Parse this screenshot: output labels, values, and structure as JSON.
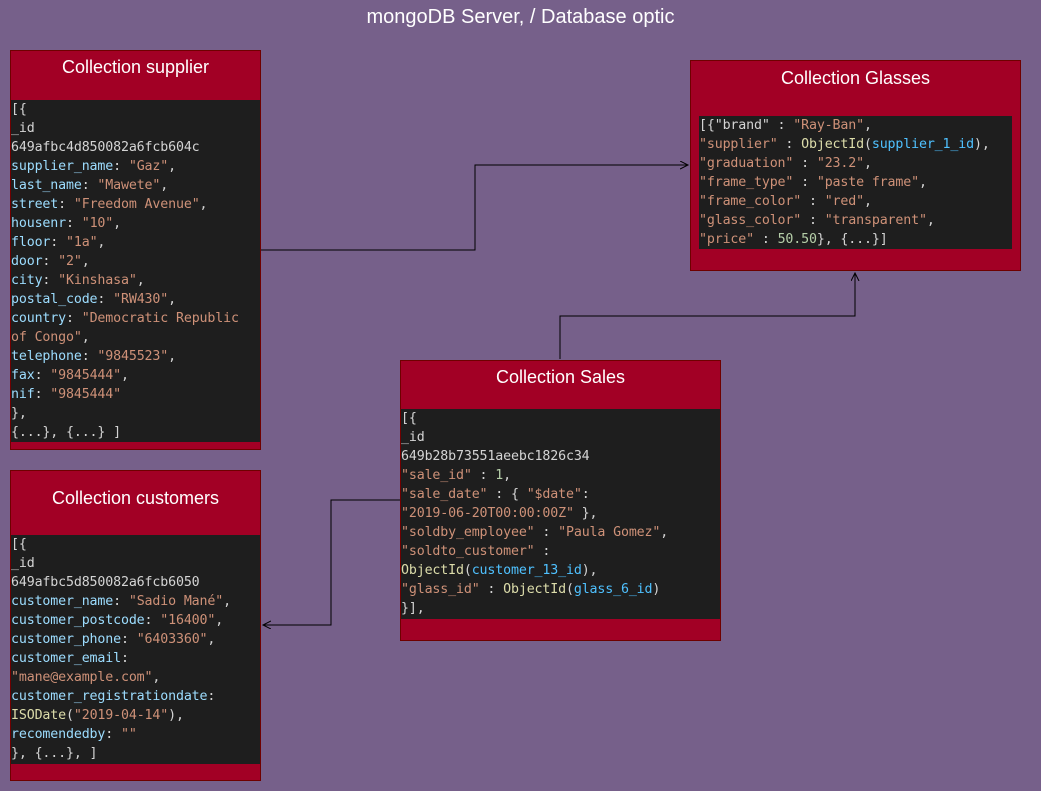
{
  "diagram_title": "mongoDB Server, / Database optic",
  "supplier": {
    "title": "Collection supplier",
    "lines": [
      [
        [
          "p",
          "[{"
        ]
      ],
      [
        [
          "p",
          "_id"
        ]
      ],
      [
        [
          "p",
          "649afbc4d850082a6fcb604c"
        ]
      ],
      [
        [
          "k",
          "supplier_name"
        ],
        [
          "p",
          ": "
        ],
        [
          "s",
          "\"Gaz\""
        ],
        [
          "p",
          ","
        ]
      ],
      [
        [
          "k",
          "last_name"
        ],
        [
          "p",
          ": "
        ],
        [
          "s",
          "\"Mawete\""
        ],
        [
          "p",
          ","
        ]
      ],
      [
        [
          "k",
          "street"
        ],
        [
          "p",
          ": "
        ],
        [
          "s",
          "\"Freedom Avenue\""
        ],
        [
          "p",
          ","
        ]
      ],
      [
        [
          "k",
          "housenr"
        ],
        [
          "p",
          ": "
        ],
        [
          "s",
          "\"10\""
        ],
        [
          "p",
          ","
        ]
      ],
      [
        [
          "k",
          "floor"
        ],
        [
          "p",
          ": "
        ],
        [
          "s",
          "\"1a\""
        ],
        [
          "p",
          ","
        ]
      ],
      [
        [
          "k",
          "door"
        ],
        [
          "p",
          ": "
        ],
        [
          "s",
          "\"2\""
        ],
        [
          "p",
          ","
        ]
      ],
      [
        [
          "k",
          "city"
        ],
        [
          "p",
          ": "
        ],
        [
          "s",
          "\"Kinshasa\""
        ],
        [
          "p",
          ","
        ]
      ],
      [
        [
          "k",
          "postal_code"
        ],
        [
          "p",
          ": "
        ],
        [
          "s",
          "\"RW430\""
        ],
        [
          "p",
          ","
        ]
      ],
      [
        [
          "k",
          "country"
        ],
        [
          "p",
          ": "
        ],
        [
          "s",
          "\"Democratic Republic"
        ]
      ],
      [
        [
          "s",
          "of Congo\""
        ],
        [
          "p",
          ","
        ]
      ],
      [
        [
          "k",
          "telephone"
        ],
        [
          "p",
          ": "
        ],
        [
          "s",
          "\"9845523\""
        ],
        [
          "p",
          ","
        ]
      ],
      [
        [
          "k",
          "fax"
        ],
        [
          "p",
          ": "
        ],
        [
          "s",
          "\"9845444\""
        ],
        [
          "p",
          ","
        ]
      ],
      [
        [
          "k",
          "nif"
        ],
        [
          "p",
          ": "
        ],
        [
          "s",
          "\"9845444\""
        ]
      ],
      [
        [
          "p",
          "},"
        ]
      ],
      [
        [
          "p",
          "{...}, {...} ]"
        ]
      ]
    ]
  },
  "glasses": {
    "title": "Collection Glasses",
    "lines": [
      [
        [
          "p",
          "[{\"brand\" : "
        ],
        [
          "s",
          "\"Ray-Ban\""
        ],
        [
          "p",
          ","
        ]
      ],
      [
        [
          "s",
          "\"supplier\""
        ],
        [
          "p",
          " : "
        ],
        [
          "f",
          "ObjectId"
        ],
        [
          "p",
          "("
        ],
        [
          "v",
          "supplier_1_id"
        ],
        [
          "p",
          "),"
        ]
      ],
      [
        [
          "s",
          "\"graduation\""
        ],
        [
          "p",
          " : "
        ],
        [
          "s",
          "\"23.2\""
        ],
        [
          "p",
          ","
        ]
      ],
      [
        [
          "s",
          "\"frame_type\""
        ],
        [
          "p",
          " : "
        ],
        [
          "s",
          "\"paste frame\""
        ],
        [
          "p",
          ","
        ]
      ],
      [
        [
          "s",
          "\"frame_color\""
        ],
        [
          "p",
          " : "
        ],
        [
          "s",
          "\"red\""
        ],
        [
          "p",
          ","
        ]
      ],
      [
        [
          "s",
          "\"glass_color\""
        ],
        [
          "p",
          " : "
        ],
        [
          "s",
          "\"transparent\""
        ],
        [
          "p",
          ","
        ]
      ],
      [
        [
          "s",
          "\"price\""
        ],
        [
          "p",
          " : "
        ],
        [
          "n",
          "50.50"
        ],
        [
          "p",
          "}, {...}]"
        ]
      ]
    ]
  },
  "sales": {
    "title": "Collection Sales",
    "lines": [
      [
        [
          "p",
          "[{"
        ]
      ],
      [
        [
          "p",
          "_id"
        ]
      ],
      [
        [
          "p",
          "649b28b73551aeebc1826c34"
        ]
      ],
      [
        [
          "s",
          "\"sale_id\""
        ],
        [
          "p",
          " : "
        ],
        [
          "n",
          "1"
        ],
        [
          "p",
          ","
        ]
      ],
      [
        [
          "s",
          "\"sale_date\""
        ],
        [
          "p",
          " : { "
        ],
        [
          "s",
          "\"$date\""
        ],
        [
          "p",
          ":"
        ]
      ],
      [
        [
          "s",
          "\"2019-06-20T00:00:00Z\""
        ],
        [
          "p",
          " },"
        ]
      ],
      [
        [
          "s",
          "\"soldby_employee\""
        ],
        [
          "p",
          " : "
        ],
        [
          "s",
          "\"Paula Gomez\""
        ],
        [
          "p",
          ","
        ]
      ],
      [
        [
          "s",
          "\"soldto_customer\""
        ],
        [
          "p",
          " :"
        ]
      ],
      [
        [
          "f",
          "ObjectId"
        ],
        [
          "p",
          "("
        ],
        [
          "v",
          "customer_13_id"
        ],
        [
          "p",
          "),"
        ]
      ],
      [
        [
          "s",
          "\"glass_id\""
        ],
        [
          "p",
          " : "
        ],
        [
          "f",
          "ObjectId"
        ],
        [
          "p",
          "("
        ],
        [
          "v",
          "glass_6_id"
        ],
        [
          "p",
          ")"
        ]
      ],
      [
        [
          "p",
          "}],"
        ]
      ]
    ]
  },
  "customers": {
    "title": "Collection customers",
    "lines": [
      [
        [
          "p",
          "[{"
        ]
      ],
      [
        [
          "p",
          "_id"
        ]
      ],
      [
        [
          "p",
          "649afbc5d850082a6fcb6050"
        ]
      ],
      [
        [
          "k",
          "customer_name"
        ],
        [
          "p",
          ": "
        ],
        [
          "s",
          "\"Sadio Mané\""
        ],
        [
          "p",
          ","
        ]
      ],
      [
        [
          "k",
          "customer_postcode"
        ],
        [
          "p",
          ": "
        ],
        [
          "s",
          "\"16400\""
        ],
        [
          "p",
          ","
        ]
      ],
      [
        [
          "k",
          "customer_phone"
        ],
        [
          "p",
          ": "
        ],
        [
          "s",
          "\"6403360\""
        ],
        [
          "p",
          ","
        ]
      ],
      [
        [
          "k",
          "customer_email"
        ],
        [
          "p",
          ":"
        ]
      ],
      [
        [
          "s",
          "\"mane@example.com\""
        ],
        [
          "p",
          ","
        ]
      ],
      [
        [
          "k",
          "customer_registrationdate"
        ],
        [
          "p",
          ":"
        ]
      ],
      [
        [
          "f",
          "ISODate"
        ],
        [
          "p",
          "("
        ],
        [
          "s",
          "\"2019-04-14\""
        ],
        [
          "p",
          "),"
        ]
      ],
      [
        [
          "k",
          "recomendedby"
        ],
        [
          "p",
          ": "
        ],
        [
          "s",
          "\"\""
        ]
      ],
      [
        [
          "p",
          "}, {...}, ]"
        ]
      ]
    ]
  },
  "colors": {
    "background": "#76608a",
    "box_fill": "#a20025",
    "code_bg": "#1e1e1e"
  }
}
